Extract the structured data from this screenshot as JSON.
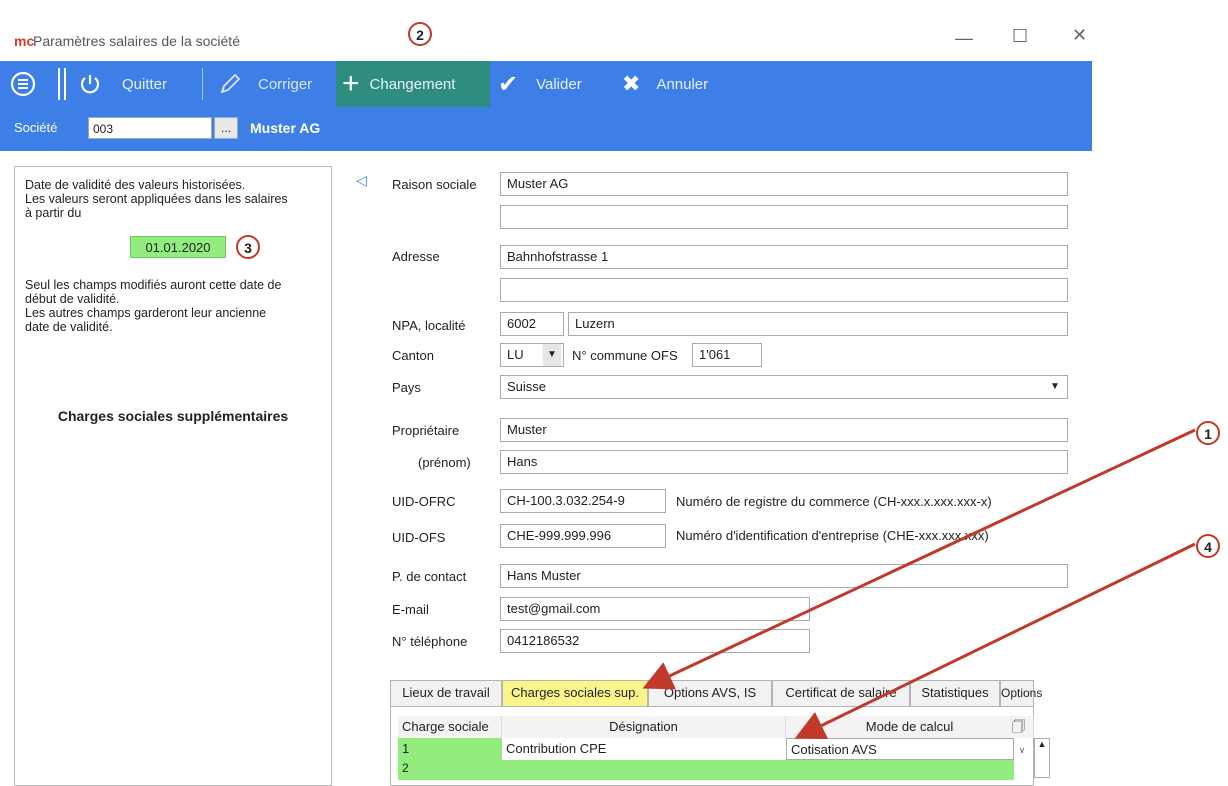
{
  "window": {
    "logo_text": "mc",
    "title": "Paramètres salaires de la société"
  },
  "toolbar": {
    "quit_label": "Quitter",
    "edit_label": "Corriger",
    "change_label": "Changement",
    "validate_label": "Valider",
    "cancel_label": "Annuler"
  },
  "company": {
    "label": "Société",
    "code": "003",
    "browse_label": "...",
    "name": "Muster AG"
  },
  "left_panel": {
    "intro_line1": "Date de validité des valeurs historisées.",
    "intro_line2": "Les valeurs seront appliquées dans les salaires",
    "intro_line3": "à partir du",
    "validity_date": "01.01.2020",
    "note_line1": "Seul les champs modifiés auront cette date de",
    "note_line2": "début de validité.",
    "note_line3": "Les autres champs garderont leur ancienne",
    "note_line4": "date de validité.",
    "section_title": "Charges sociales supplémentaires"
  },
  "form": {
    "company_name_label": "Raison sociale",
    "company_name": "Muster AG",
    "company_name_2": "",
    "address_label": "Adresse",
    "address": "Bahnhofstrasse 1",
    "address_2": "",
    "zip_city_label": "NPA, localité",
    "zip": "6002",
    "city": "Luzern",
    "canton_label": "Canton",
    "canton": "LU",
    "ofs_label": "N° commune OFS",
    "ofs_number": "1'061",
    "country_label": "Pays",
    "country": "Suisse",
    "owner_label": "Propriétaire",
    "owner": "Muster",
    "firstname_label": "(prénom)",
    "firstname": "Hans",
    "uid_ofrc_label": "UID-OFRC",
    "uid_ofrc": "CH-100.3.032.254-9",
    "uid_ofrc_hint": "Numéro de registre du commerce (CH-xxx.x.xxx.xxx-x)",
    "uid_ofs_label": "UID-OFS",
    "uid_ofs": "CHE-999.999.996",
    "uid_ofs_hint": "Numéro d'identification d'entreprise (CHE-xxx.xxx.xxx)",
    "contact_label": "P. de contact",
    "contact": "Hans Muster",
    "email_label": "E-mail",
    "email": "test@gmail.com",
    "phone_label": "N° téléphone",
    "phone": "0412186532"
  },
  "tabs": [
    {
      "label": "Lieux de travail"
    },
    {
      "label": "Charges sociales sup."
    },
    {
      "label": "Options AVS, IS"
    },
    {
      "label": "Certificat de salaire"
    },
    {
      "label": "Statistiques"
    },
    {
      "label": "Options"
    }
  ],
  "table": {
    "headers": [
      "Charge sociale",
      "Désignation",
      "Mode de calcul"
    ],
    "rows": [
      {
        "charge": "1",
        "designation": "Contribution CPE",
        "mode": "Cotisation AVS"
      },
      {
        "charge": "2",
        "designation": "",
        "mode": ""
      }
    ]
  },
  "annotations": {
    "badge1": "1",
    "badge2": "2",
    "badge3": "3",
    "badge4": "4"
  },
  "colors": {
    "toolbar": "#3d7fe6",
    "active_button": "#2f8d80",
    "highlight_green": "#92ed7e",
    "active_tab": "#fbf58c",
    "arrow_red": "#c0392b"
  },
  "icons": {
    "menu": "menu-icon",
    "quit": "power-icon",
    "edit": "pencil-icon",
    "change": "plus-icon",
    "validate": "checkmark-icon",
    "cancel": "x-icon"
  }
}
